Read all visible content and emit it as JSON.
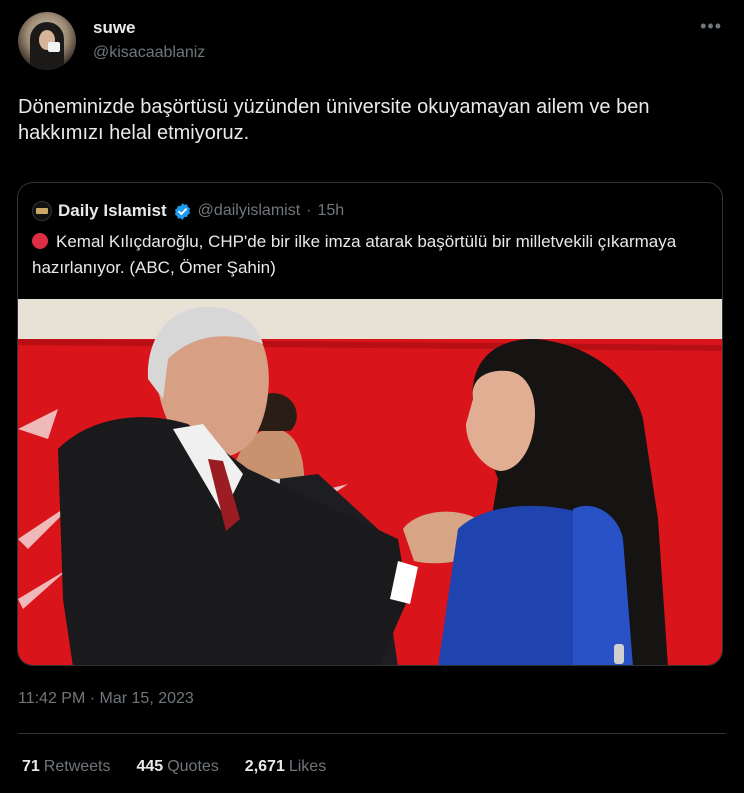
{
  "author": {
    "display_name": "suwe",
    "handle": "@kisacaablaniz"
  },
  "more_icon": "more-horizontal-icon",
  "tweet": {
    "text": "Döneminizde başörtüsü yüzünden üniversite okuyamayan ailem ve ben hakkımızı helal etmiyoruz."
  },
  "quoted": {
    "display_name": "Daily Islamist",
    "verified_icon": "verified-badge-icon",
    "handle": "@dailyislamist",
    "separator": "·",
    "time": "15h",
    "emoji": "red-circle-icon",
    "text": "Kemal Kılıçdaroğlu, CHP'de bir ilke imza atarak başörtülü bir milletvekili çıkarmaya hazırlanıyor. (ABC, Ömer Şahin)"
  },
  "timestamp": "11:42 PM · Mar 15, 2023",
  "stats": {
    "retweets_count": "71",
    "retweets_label": "Retweets",
    "quotes_count": "445",
    "quotes_label": "Quotes",
    "likes_count": "2,671",
    "likes_label": "Likes"
  },
  "colors": {
    "background": "#000000",
    "text_primary": "#e7e9ea",
    "text_secondary": "#71767b",
    "border": "#2f3336",
    "verified": "#1d9bf0",
    "photo_backdrop_red": "#d9141b"
  }
}
